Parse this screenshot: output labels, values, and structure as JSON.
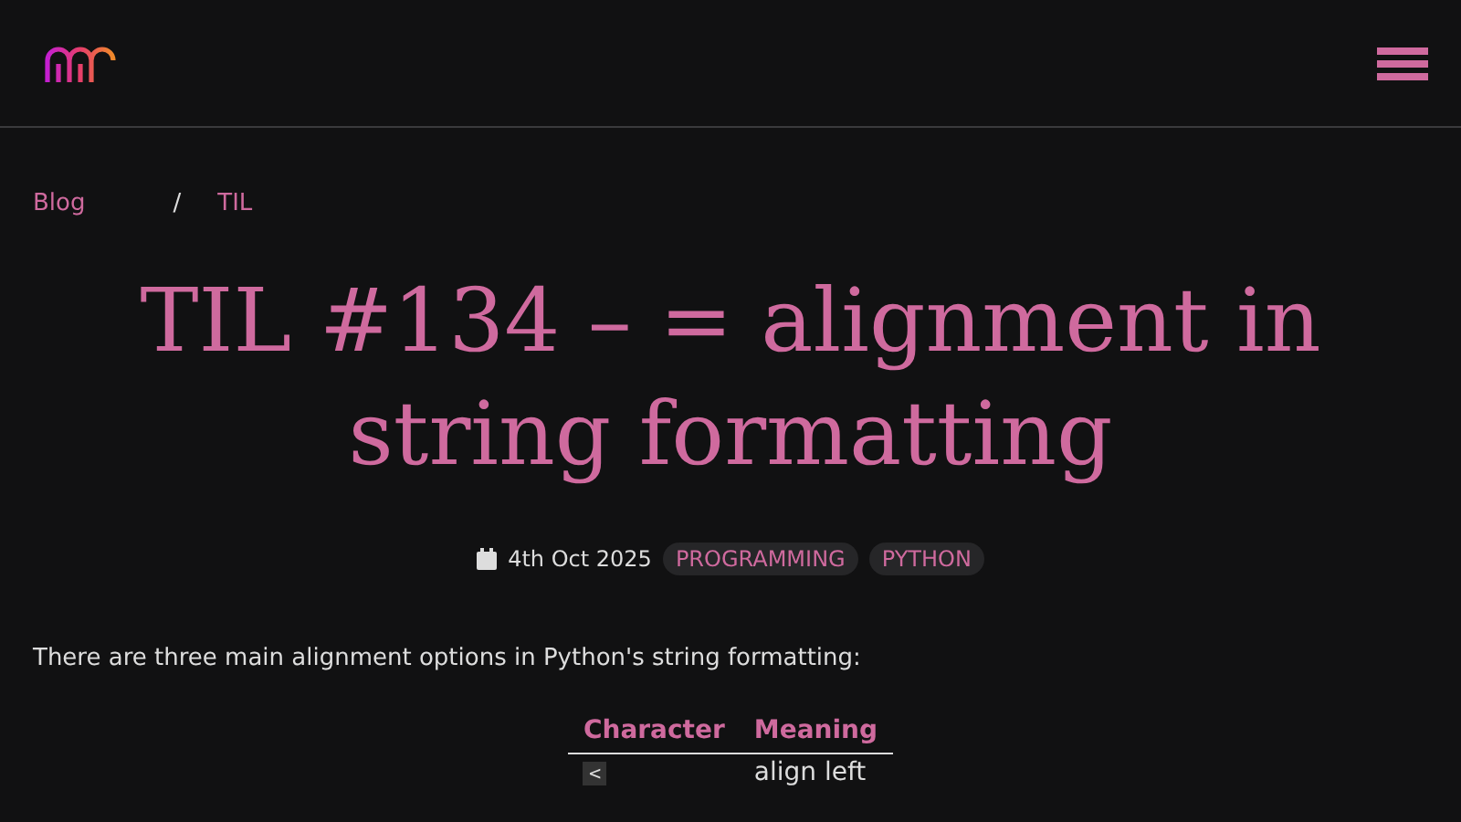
{
  "breadcrumb": [
    {
      "label": "Blog"
    },
    {
      "label": "TIL"
    }
  ],
  "breadcrumb_separator": "/",
  "title": "TIL #134 – = alignment in string formatting",
  "meta": {
    "date": "4th Oct 2025",
    "tags": [
      "PROGRAMMING",
      "PYTHON"
    ]
  },
  "paragraph": "There are three main alignment options in Python's string formatting:",
  "table": {
    "columns": [
      "Character",
      "Meaning"
    ],
    "rows": [
      {
        "character": "<",
        "meaning": "align left"
      }
    ]
  }
}
